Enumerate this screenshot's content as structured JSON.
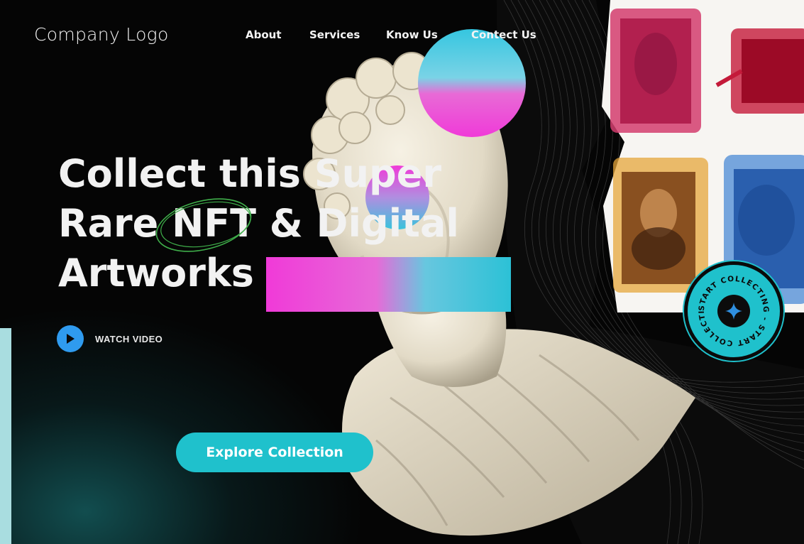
{
  "nav": {
    "logo": "Company Logo",
    "links": [
      "About",
      "Services",
      "Know Us",
      "Contect Us"
    ]
  },
  "hero": {
    "headline_lines": [
      "Collect this Super",
      "Rare NFT & Digital",
      "Artworks"
    ],
    "watch_label": "WATCH VIDEO",
    "cta_label": "Explore Collection"
  },
  "badge": {
    "ring_text": "START COLLECTING - START COLLECTING - "
  },
  "colors": {
    "accent": "#1fc1cc",
    "play": "#2f9bef",
    "magenta": "#f040d8",
    "background": "#050505"
  },
  "icons": {
    "play": "play-icon",
    "star": "sparkle-star-icon",
    "underline": "scribble-ellipse-icon"
  }
}
